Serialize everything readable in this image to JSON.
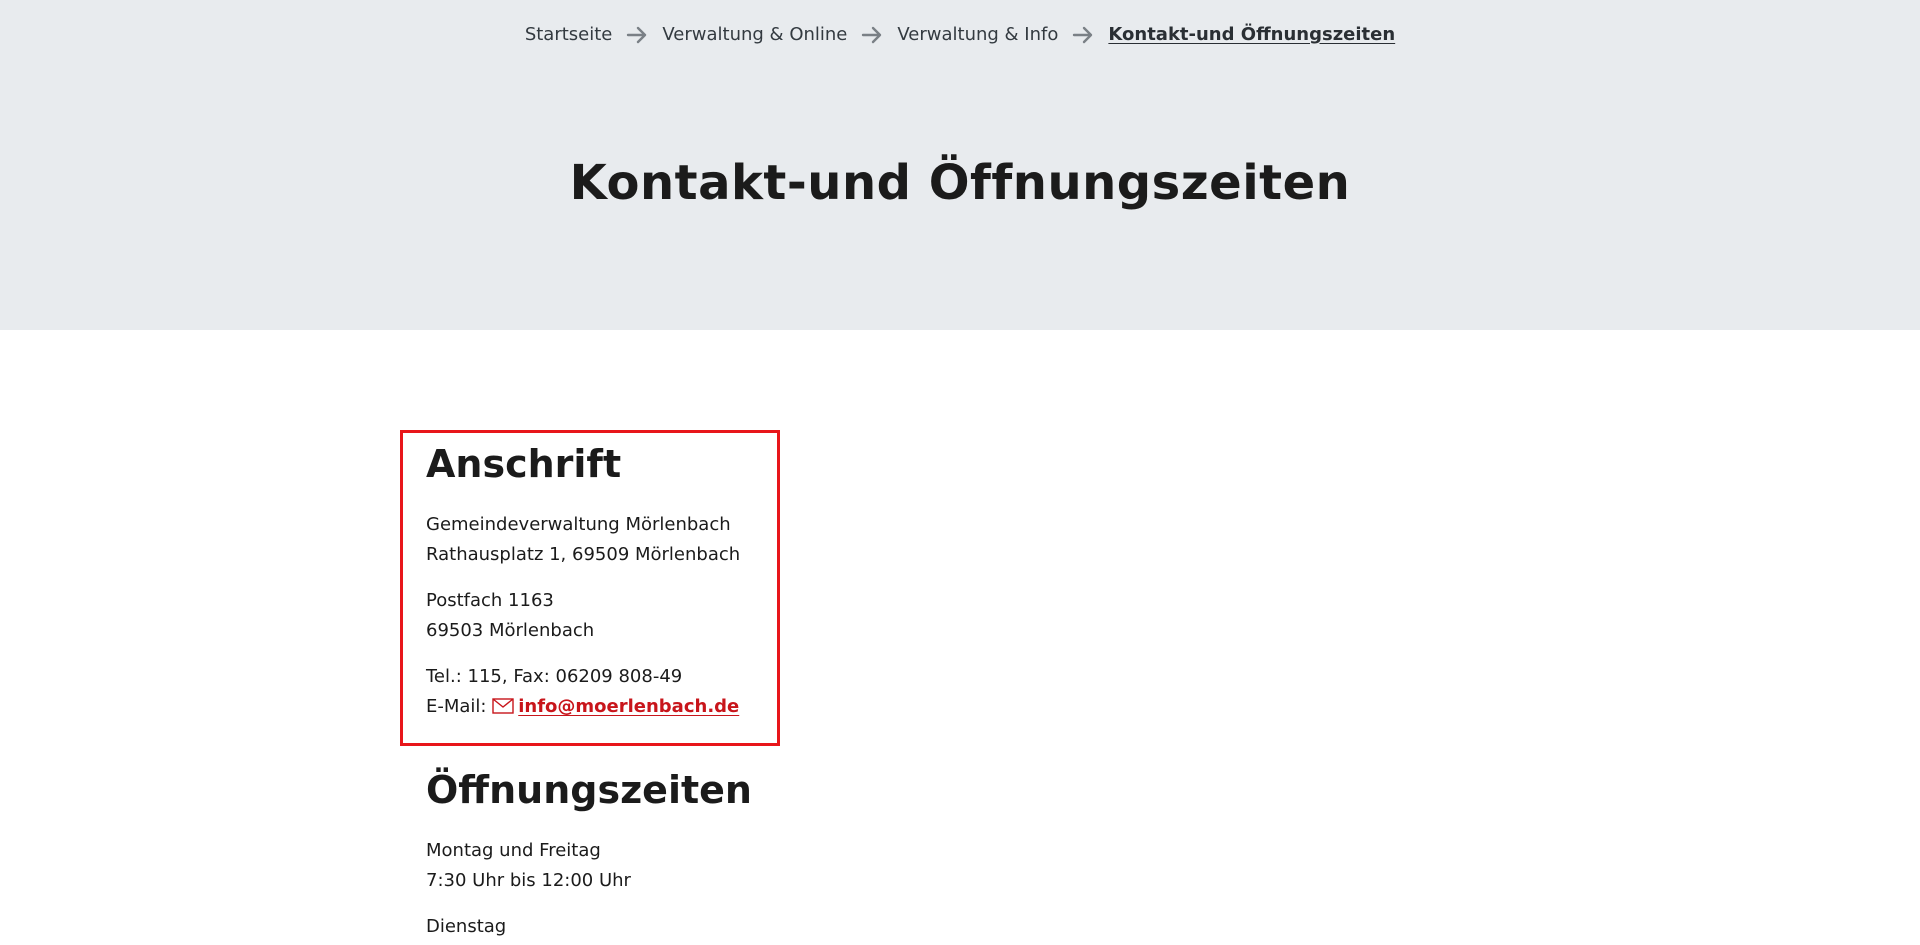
{
  "breadcrumb": {
    "items": [
      {
        "label": "Startseite"
      },
      {
        "label": "Verwaltung & Online"
      },
      {
        "label": "Verwaltung & Info"
      },
      {
        "label": "Kontakt-und Öffnungszeiten"
      }
    ]
  },
  "page_title": "Kontakt-und Öffnungszeiten",
  "anschrift": {
    "heading": "Anschrift",
    "line1": "Gemeindeverwaltung Mörlenbach",
    "line2": "Rathausplatz 1, 69509 Mörlenbach",
    "line3": "Postfach 1163",
    "line4": "69503 Mörlenbach",
    "line5": "Tel.: 115, Fax: 06209 808-49",
    "email_label": "E-Mail: ",
    "email": "info@moerlenbach.de"
  },
  "oeffnungszeiten": {
    "heading": "Öffnungszeiten",
    "line1": "Montag und Freitag",
    "line2": "7:30 Uhr bis 12:00 Uhr",
    "line3": "Dienstag"
  },
  "colors": {
    "hero_bg": "#e8ebee",
    "accent_red": "#c8151b",
    "highlight_border": "#e8161a"
  },
  "icons": {
    "breadcrumb_separator": "arrow-right-icon",
    "email": "envelope-icon"
  }
}
